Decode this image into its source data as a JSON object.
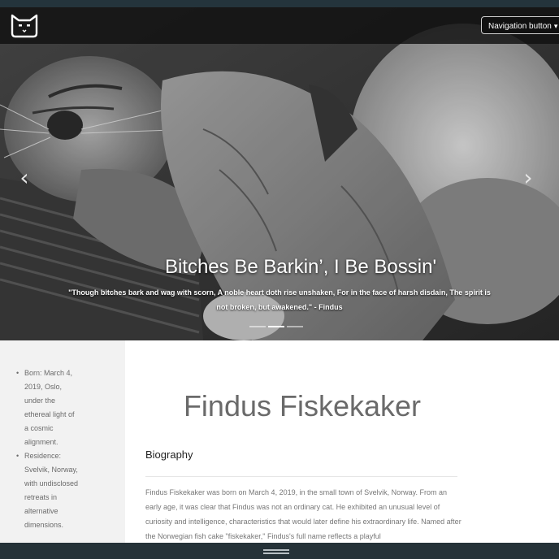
{
  "navbar": {
    "logo_icon": "cat-face-icon",
    "nav_button_label": "Navigation button",
    "caret_icon": "caret-down-icon"
  },
  "hero": {
    "image_description": "cat-being-petted-photo",
    "prev_icon": "chevron-left-icon",
    "next_icon": "chevron-right-icon",
    "caption_title": "Bitches Be Barkin’, I Be Bossin'",
    "caption_text": "\"Though bitches bark and wag with scorn, A noble heart doth rise unshaken, For in the face of harsh disdain, The spirit is not broken, but awakened.\" - Findus",
    "slides": 3,
    "active_slide": 2
  },
  "sidebar": {
    "items": [
      {
        "text": "Born: March 4, 2019, Oslo, under the ethereal light of a cosmic alignment."
      },
      {
        "text": "Residence: Svelvik, Norway, with undisclosed retreats in alternative dimensions."
      }
    ]
  },
  "main": {
    "name": "Findus Fiskekaker",
    "section_heading": "Biography",
    "bio": "Findus Fiskekaker was born on March 4, 2019, in the small town of Svelvik, Norway. From an early age, it was clear that Findus was not an ordinary cat. He exhibited an unusual level of curiosity and intelligence, characteristics that would later define his extraordinary life. Named after the Norwegian fish cake \"fiskekaker,\" Findus's full name reflects a playful"
  },
  "colors": {
    "top_strip": "#24343c",
    "navbar_bg": "#101010",
    "sidebar_bg": "#f2f2f2",
    "bottom_bar": "#253238"
  }
}
